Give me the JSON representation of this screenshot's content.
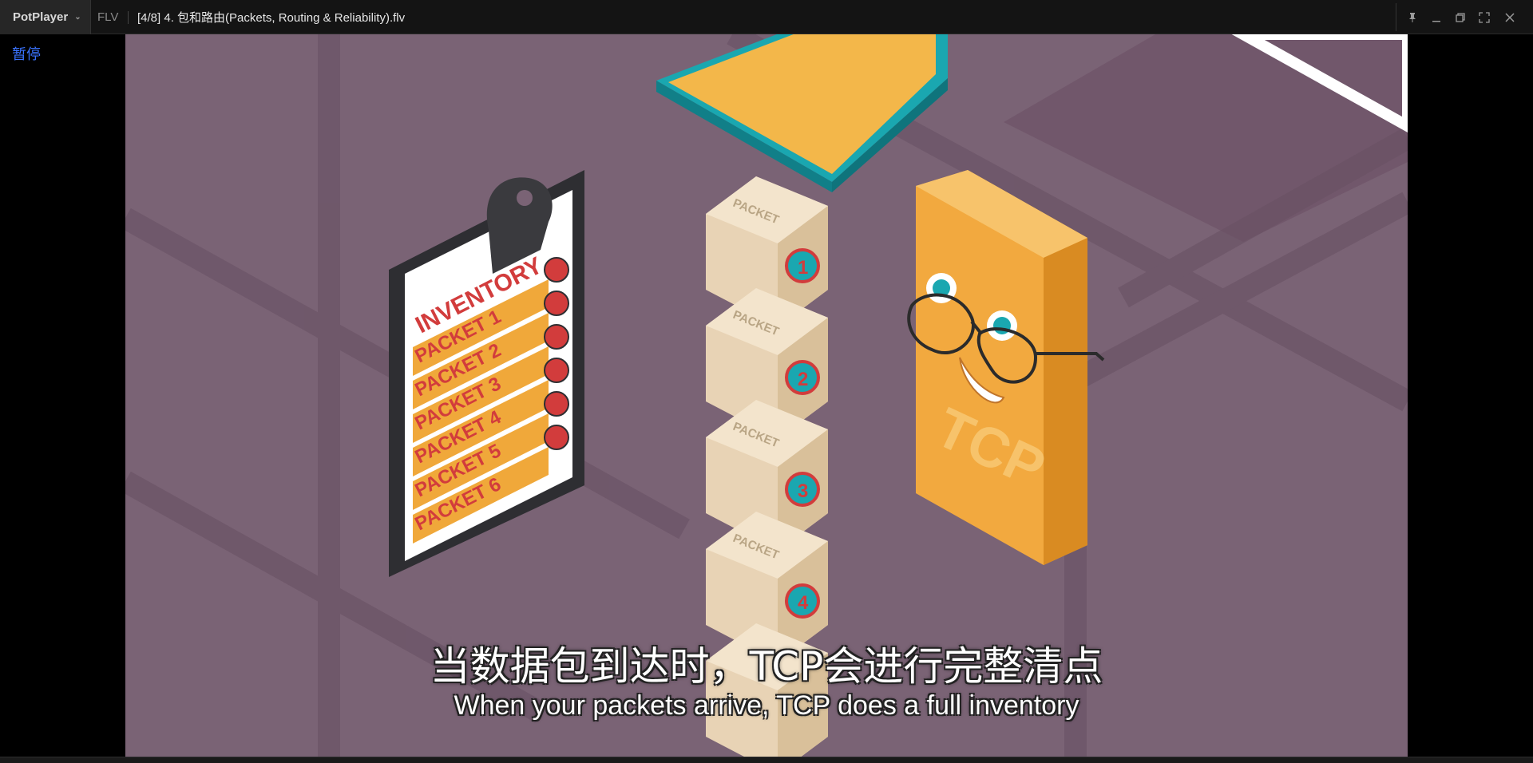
{
  "app": {
    "name": "PotPlayer",
    "format": "FLV",
    "title": "[4/8] 4. 包和路由(Packets, Routing & Reliability).flv",
    "status": "暂停"
  },
  "window_controls": [
    "pin-icon",
    "minimize-icon",
    "restore-icon",
    "fullscreen-icon",
    "close-icon"
  ],
  "video": {
    "clipboard": {
      "header": "INVENTORY",
      "items": [
        "PACKET 1",
        "PACKET 2",
        "PACKET 3",
        "PACKET 4",
        "PACKET 5",
        "PACKET 6"
      ]
    },
    "box_label": "PACKET",
    "box_numbers": [
      "1",
      "2",
      "3",
      "4"
    ],
    "tcp_label": "TCP",
    "colors": {
      "background": "#7a6375",
      "clipboard_row": "#f0a83a",
      "tcp": "#f2a93f",
      "laptop": "#1aa7b0"
    }
  },
  "subtitles": {
    "zh": "当数据包到达时，TCP会进行完整清点",
    "en": "When your packets arrive, TCP does a full inventory"
  }
}
